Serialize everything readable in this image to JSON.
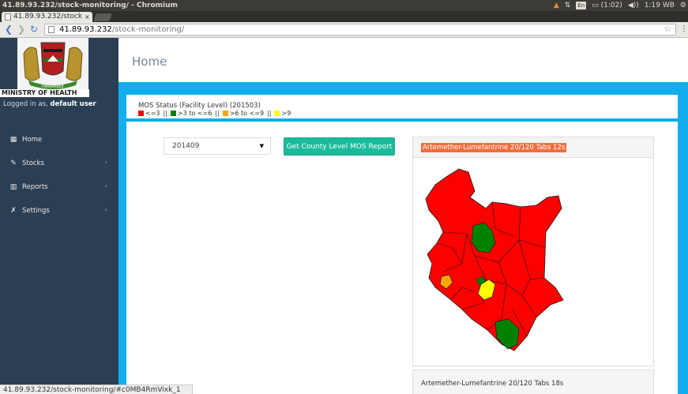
{
  "window": {
    "title": "41.89.93.232/stock-monitoring/ - Chromium",
    "tray": {
      "keyboard": "En",
      "battery": "(1:02)",
      "clock": "1:19 WB"
    }
  },
  "browser": {
    "tab_label": "41.89.93.232/stock-",
    "url_host": "41.89.93.232",
    "url_path": "/stock-monitoring/",
    "status_url": "41.89.93.232/stock-monitoring/#c0MB4RmVixk_1"
  },
  "sidebar": {
    "ministry": "MINISTRY OF HEALTH",
    "logged_prefix": "Logged in as,",
    "user": "default user",
    "items": [
      {
        "label": "Home",
        "icon": "table-icon",
        "glyph": "▦",
        "has_chevron": false
      },
      {
        "label": "Stocks",
        "icon": "edit-icon",
        "glyph": "✎",
        "has_chevron": true
      },
      {
        "label": "Reports",
        "icon": "bar-chart-icon",
        "glyph": "▥",
        "has_chevron": true
      },
      {
        "label": "Settings",
        "icon": "wrench-icon",
        "glyph": "✗",
        "has_chevron": true
      }
    ],
    "chevron": "‹"
  },
  "page": {
    "title": "Home",
    "mos_title": "MOS Status (Facility Level) (201503)",
    "legend": [
      {
        "color": "#ff0000",
        "label": "<=3"
      },
      {
        "color": "#008000",
        "label": ">3 to <=6"
      },
      {
        "color": "#ffa500",
        "label": ">6 to <=9"
      },
      {
        "color": "#ffff00",
        "label": ">9"
      }
    ],
    "legend_sep": "||",
    "period_value": "201409",
    "report_button": "Get County Level MOS Report",
    "map1_title": "Artemether-Lumefantrine 20/120 Tabs 12s",
    "map2_title": "Artemether-Lumefantrine 20/120 Tabs 18s"
  },
  "colors": {
    "sidebar": "#2a3f54",
    "main_bg": "#10aeee",
    "button": "#1abb9c",
    "map_title_bg": "#f26d3d"
  }
}
